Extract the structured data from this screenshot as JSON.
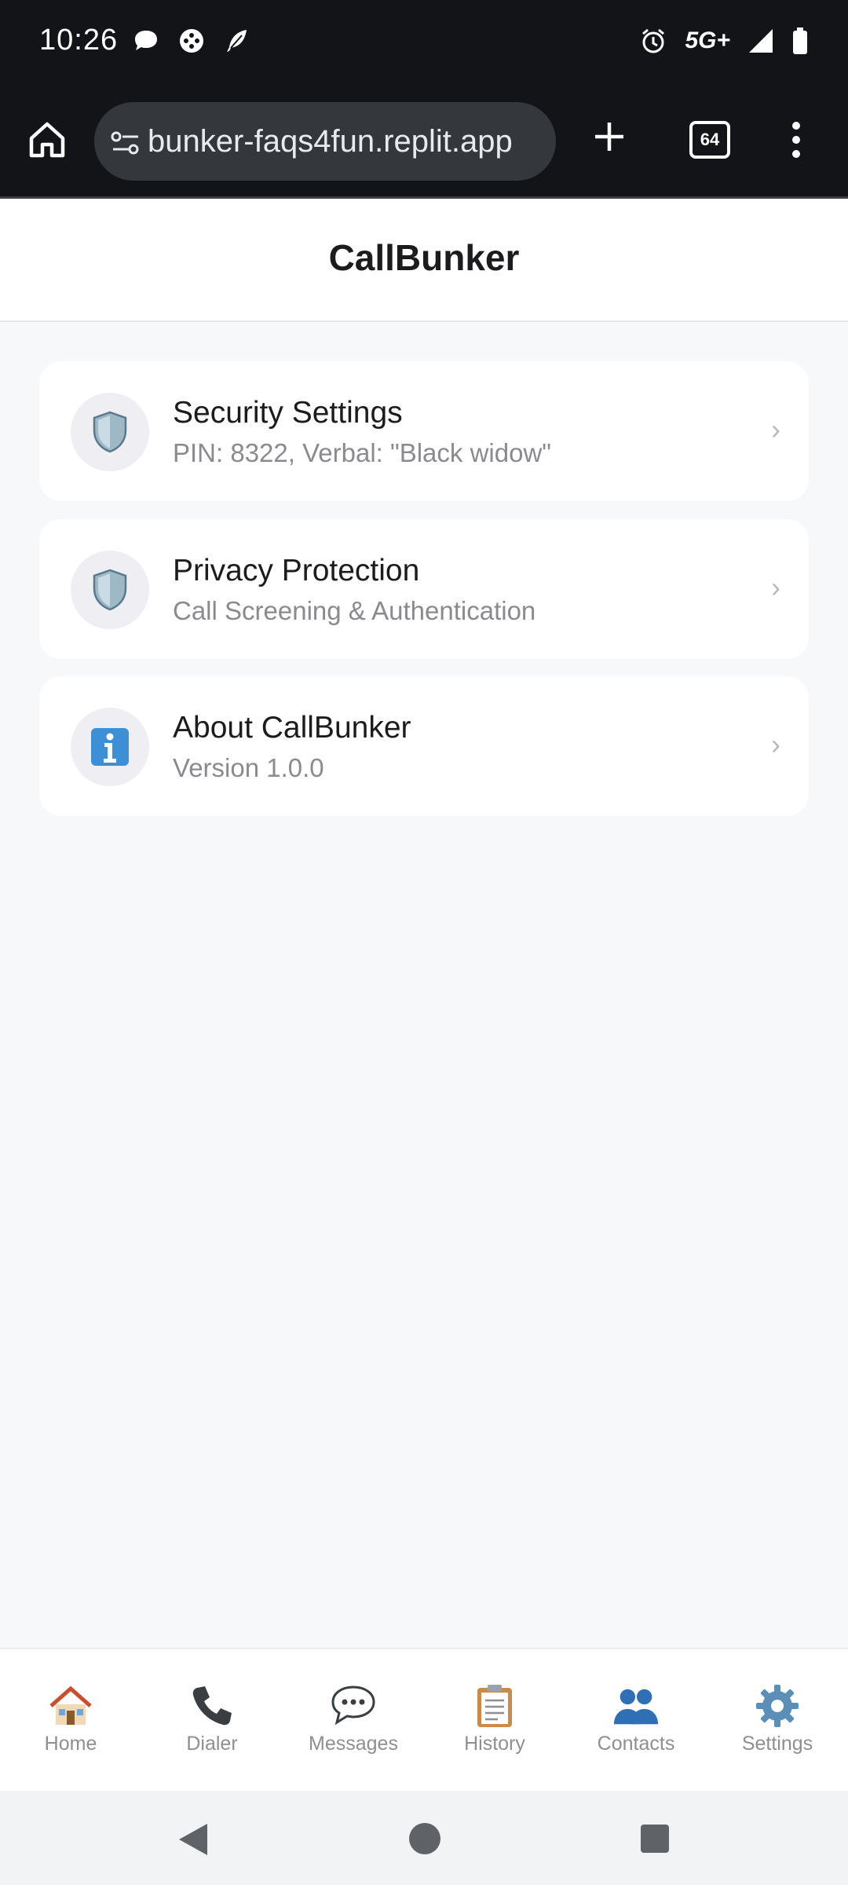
{
  "status_bar": {
    "time": "10:26",
    "network": "5G+",
    "icons": [
      "chat-bubble-icon",
      "game-controller-icon",
      "feather-icon",
      "alarm-icon",
      "signal-icon",
      "battery-icon"
    ]
  },
  "browser": {
    "url": "bunker-faqs4fun.replit.app",
    "tab_count": "64"
  },
  "header": {
    "title": "CallBunker"
  },
  "menu_items": [
    {
      "title": "Security Settings",
      "subtitle": "PIN: 8322, Verbal: \"Black widow\"",
      "icon": "shield-icon"
    },
    {
      "title": "Privacy Protection",
      "subtitle": "Call Screening & Authentication",
      "icon": "shield-icon"
    },
    {
      "title": "About CallBunker",
      "subtitle": "Version 1.0.0",
      "icon": "info-icon"
    }
  ],
  "chevron": "›",
  "tab_bar": {
    "items": [
      {
        "label": "Home",
        "icon": "house-icon"
      },
      {
        "label": "Dialer",
        "icon": "phone-icon"
      },
      {
        "label": "Messages",
        "icon": "speech-bubble-icon"
      },
      {
        "label": "History",
        "icon": "clipboard-icon"
      },
      {
        "label": "Contacts",
        "icon": "people-icon"
      },
      {
        "label": "Settings",
        "icon": "gear-icon"
      }
    ]
  },
  "colors": {
    "background": "#f7f8fa",
    "card": "#ffffff",
    "text_primary": "#1c1c1e",
    "text_secondary": "#8a8a8f",
    "status_bar": "#121417"
  }
}
